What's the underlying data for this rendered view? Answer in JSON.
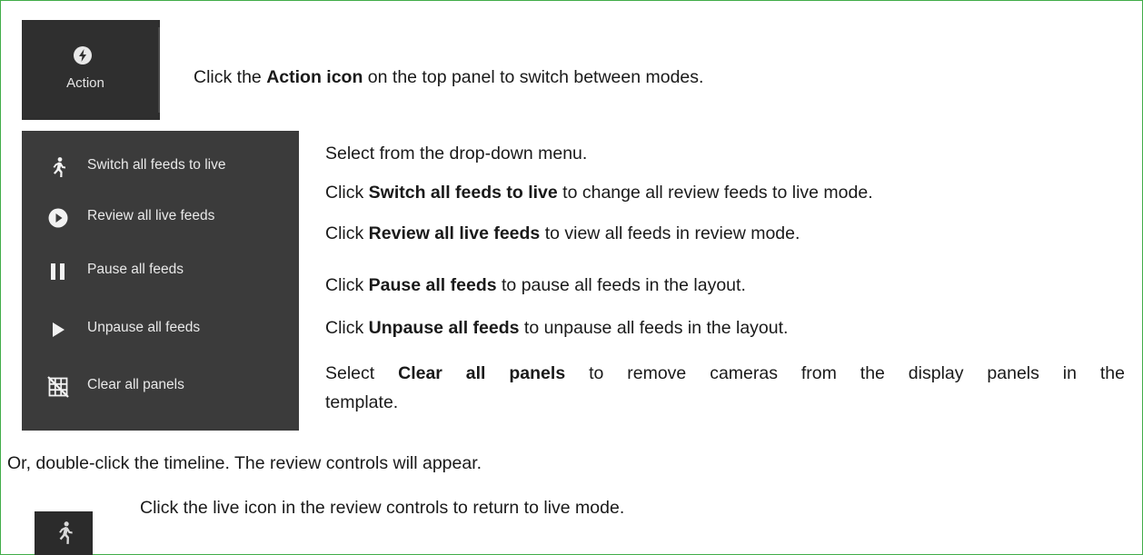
{
  "action_tile": {
    "label": "Action",
    "icon": "bolt-icon"
  },
  "intro": {
    "prefix": "Click the ",
    "bold": "Action icon",
    "suffix": " on the top panel to switch between modes."
  },
  "menu": {
    "items": [
      {
        "label": "Switch all feeds to live",
        "icon": "running-person-icon"
      },
      {
        "label": "Review all live feeds",
        "icon": "play-circle-icon"
      },
      {
        "label": "Pause all feeds",
        "icon": "pause-icon"
      },
      {
        "label": "Unpause all feeds",
        "icon": "play-icon"
      },
      {
        "label": "Clear all panels",
        "icon": "grid-clear-icon"
      }
    ]
  },
  "instructions": {
    "select_line": "Select from the drop-down menu.",
    "lines": [
      {
        "prefix": "Click ",
        "bold": "Switch all feeds to live",
        "suffix": " to change all review feeds to live mode."
      },
      {
        "prefix": "Click ",
        "bold": "Review all live feeds",
        "suffix": " to view all feeds in review mode."
      },
      {
        "prefix": "Click ",
        "bold": "Pause all feeds",
        "suffix": " to pause all feeds in the layout."
      },
      {
        "prefix": "Click ",
        "bold": "Unpause all feeds",
        "suffix": " to unpause all feeds in the layout."
      }
    ],
    "clear_line": {
      "prefix": "Select ",
      "bold": "Clear all panels",
      "suffix_1": " to remove cameras from the display panels in the",
      "suffix_2": "template."
    }
  },
  "or_line": "Or, double-click the timeline. The review controls will appear.",
  "live_line": "Click the live icon in the review controls to return to live mode."
}
